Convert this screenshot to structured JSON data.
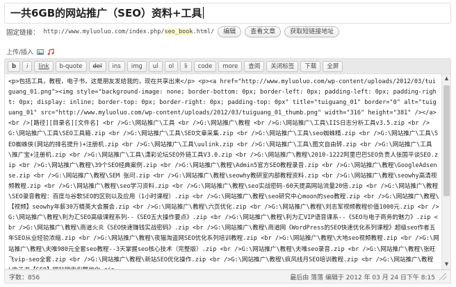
{
  "title": "一共6GB的网站推广（SEO）资料+工具",
  "permalink": {
    "label": "固定链接：",
    "url_prefix": "http://www.myluoluo.com/index.php/",
    "slug": "seo_book",
    "url_suffix": ".html/",
    "edit_label": "编辑",
    "view_label": "查看文章",
    "shortlink_label": "获取短链接地址"
  },
  "upload": {
    "label": "上传/插入",
    "icons": [
      "image-icon",
      "music-icon"
    ]
  },
  "toolbar": {
    "buttons": [
      "b",
      "i",
      "link",
      "b-quote",
      "del",
      "ins",
      "img",
      "ul",
      "ol",
      "li",
      "code",
      "more",
      "查阅",
      "关闭标签",
      "下载",
      "全屏"
    ]
  },
  "editor": {
    "content": "<p>包括工具，教程，电子书，这是朋友发给我的，现在共享出来</p>  <p><a href=\"http://www.myluoluo.com/wp-content/uploads/2012/03/tuiguang_01.png\"><img style=\"background-image: none; border-bottom: 0px; border-left: 0px; padding-left: 0px; padding-right: 0px; display: inline; border-top: 0px; border-right: 0px; padding-top: 0px\" title=\"tuiguang_01\" border=\"0\" alt=\"tuiguang_01\" src=\"http://www.myluoluo.com/wp-content/uploads/2012/03/tuiguang_01_thumb.png\" width=\"316\" height=\"381\" /></a>  <br />[路径][目录名][文件名]  <br />G:\\网站推广\\工具  <br />G:\\网站推广\\教程  <br />G:\\网站推广\\工具\\IIS日志分析工具v3.5.zip  <br />G:\\网站推广\\工具\\SEO工具箱.zip  <br />G:\\网站推广\\工具\\SEO文章采集.zip  <br />G:\\网站推广\\工具\\seo蜘蛛精.zip  <br />G:\\网站推广\\工具\\SEO蜘蛛侠(网站的排名提升)+注册机.zip  <br />G:\\网站推广\\工具\\uulink.zip  <br />G:\\网站推广\\工具\\图文自由转.zip  <br />G:\\网站推广\\工具\\推广宝+注册机.zip  <br />G:\\网站推广\\工具\\潇彩论坛SEO外链工具V3.0.zip  <br />G:\\网站推广\\教程\\2010-1222阿里巴巴SEO负责人张国平谈SEO.zip  <br />G:\\网站推广\\教程\\39个SEO经典案例.zip  <br />G:\\网站推广\\教程\\Admin5官方SEO教程录音.zip  <br />G:\\网站推广\\教程\\GoogleAdsense.zip  <br />G:\\网站推广\\教程\\SEM 张问.zip  <br />G:\\网站推广\\教程\\seowhy教研室内部教程资料.zip  <br />G:\\网站推广\\教程\\seowhy高清视频教程.zip  <br />G:\\网站推广\\教程\\seo学习资料.zip  <br />G:\\网站推广\\教程\\seo实战密码-60天提高网站流量20倍.zip  <br />G:\\网站推广\\教程\\SEO录音教程：百度与谷歌SEO的区别以及应用（1小时课程）.zip  <br />G:\\网站推广\\教程\\seo研究中心moon的seo教程.zip  <br />G:\\网站推广\\教程\\【视频】seowhy年薪30万精英大会展会.zip  <br />G:\\网站推广\\教程\\六页优化.zip  <br />G:\\网站推广\\教程\\刘志军视频教程价值1000元.zip  <br />G:\\网站推广\\教程\\利为汇SEO高级课程系列--《SEO五大操作要点》.zip  <br />G:\\网站推广\\教程\\利为汇VIP语音课系--《SEO与电子商务的魅力》.zip  <br />G:\\网站推广\\教程\\商道火炎《SEO快速赚钱实战密码》.zip  <br />G:\\网站推广\\教程\\商道网《WordPress的SEO快速优化系列课程》超级seo作者五年SEO从业经验浓缩.zip  <br />G:\\网站推广\\教程\\夜猫淘盗网SEO优化系列培训教程.zip  <br />G:\\网站推广\\教程\\大地seo视频教程.zip  <br />G:\\网站推广\\教程\\夫唯980元全套seo教程--3天掌握seo核心技术（完整版）.zip  <br />G:\\网站推广\\教程\\夫唯seo录音.zip  <br />G:\\网站推广\\教程\\张旺飞vip-seo全套.zip  <br />G:\\网站推广\\教程\\新站SEO优化操作.zip  <br />G:\\网站推广\\教程\\疯风线月SEO培训教程.zip  <br />G:\\网站推广\\教程\\电子书【SEO】网站搜索引擎优化.zip"
  },
  "status": {
    "word_count": "字数：856",
    "last_edit": "最后由 落落 编辑于 2012 年 03 月 24 日下午 8:15"
  }
}
